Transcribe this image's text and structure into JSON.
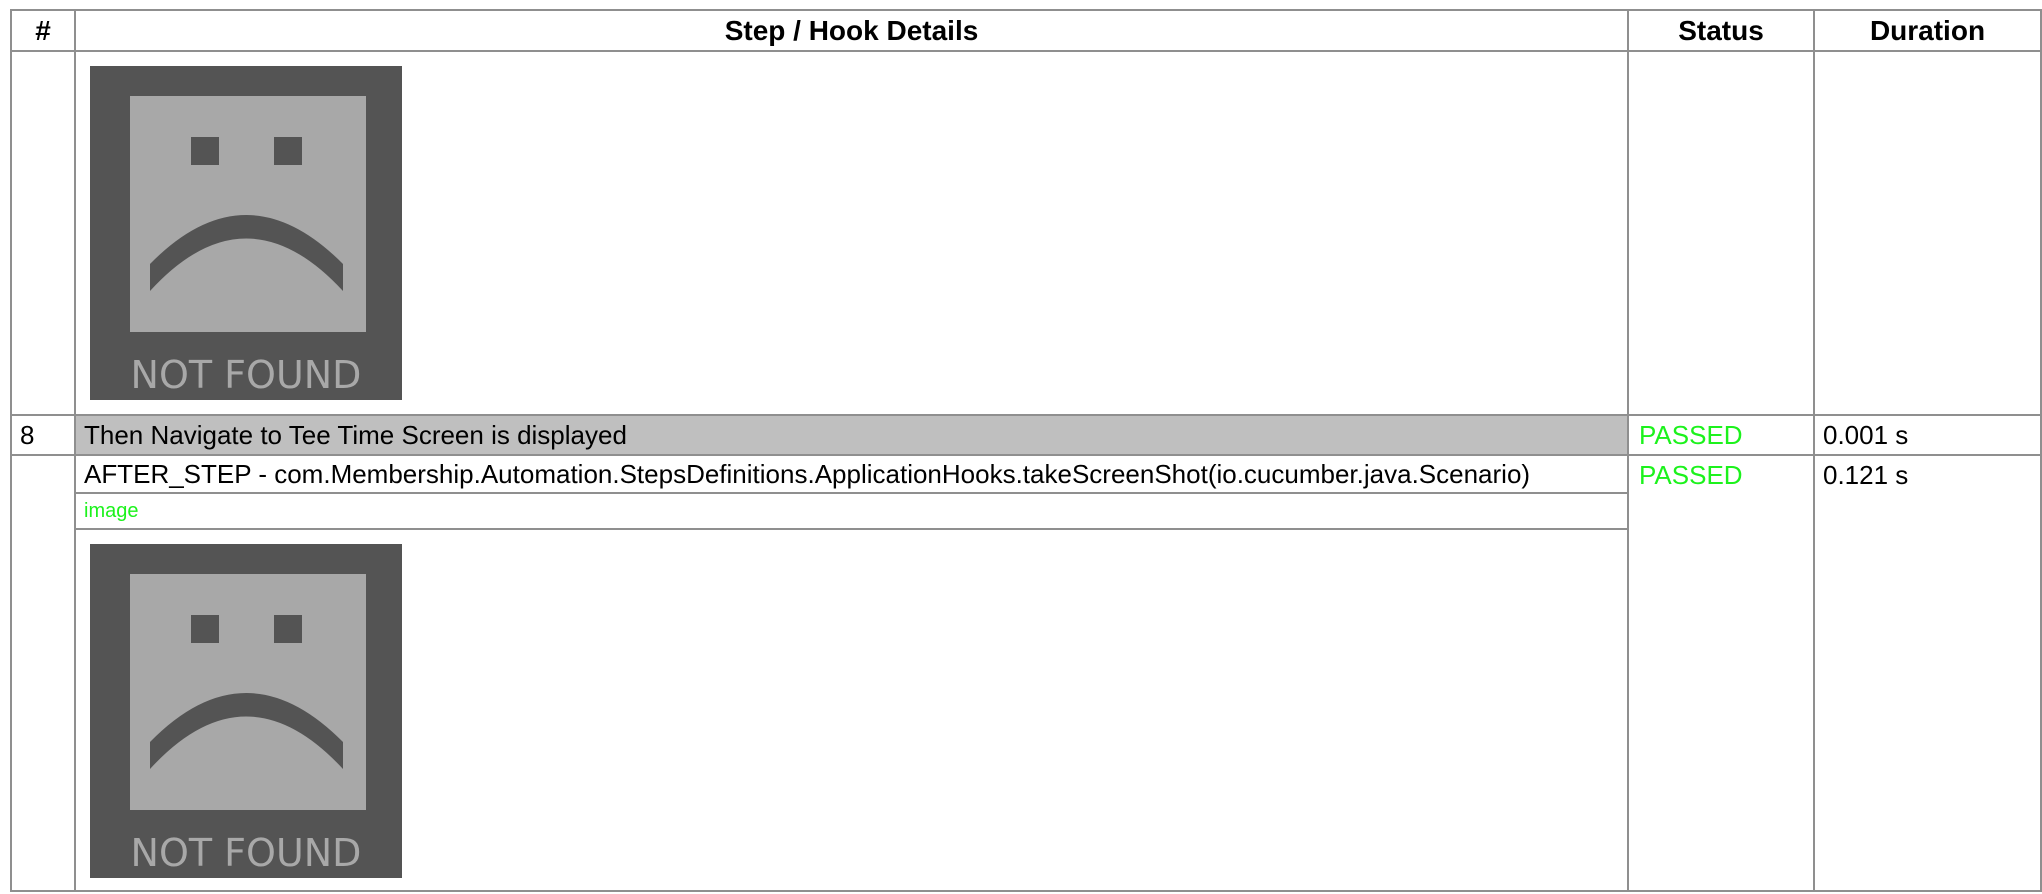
{
  "table": {
    "headers": {
      "num": "#",
      "details": "Step / Hook Details",
      "status": "Status",
      "duration": "Duration"
    }
  },
  "rows": {
    "prev_image": {
      "image_caption": "NOT FOUND"
    },
    "step8": {
      "num": "8",
      "details": "Then Navigate to Tee Time Screen is displayed",
      "status": "PASSED",
      "duration": "0.001 s"
    },
    "after_step": {
      "details": "AFTER_STEP - com.Membership.Automation.StepsDefinitions.ApplicationHooks.takeScreenShot(io.cucumber.java.Scenario)",
      "embed_label": "image",
      "status": "PASSED",
      "duration": "0.121 s",
      "image_caption": "NOT FOUND"
    }
  },
  "icons": {
    "broken_image": "sad-face-not-found-icon"
  },
  "colors": {
    "passed": "#1cf21c",
    "step_row_bg": "#bfbfbf",
    "border": "#8f8f8f",
    "image_dark": "#545454",
    "image_light": "#a8a8a8"
  }
}
